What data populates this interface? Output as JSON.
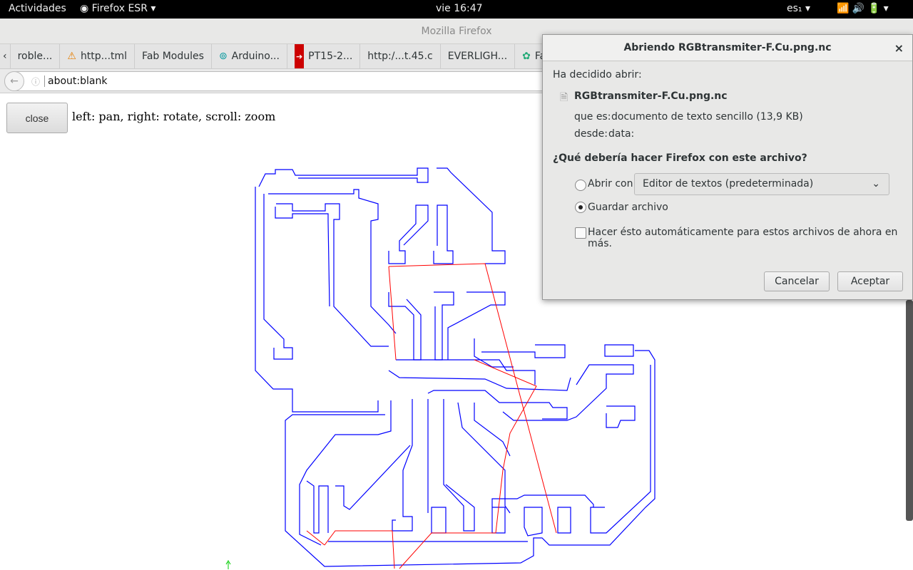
{
  "topbar": {
    "activities": "Actividades",
    "app": "Firefox ESR",
    "clock": "vie 16:47",
    "lang": "es₁"
  },
  "window": {
    "title": "Mozilla Firefox"
  },
  "tabs": [
    {
      "label": "roble...",
      "icon": ""
    },
    {
      "label": "http...tml",
      "icon": "warning-icon"
    },
    {
      "label": "Fab Modules",
      "icon": ""
    },
    {
      "label": "Arduino...",
      "icon": "arduino-icon"
    },
    {
      "label": "PT15-2...",
      "icon": "arrow-icon"
    },
    {
      "label": "http:/...t.45.c",
      "icon": ""
    },
    {
      "label": "EVERLIGH...",
      "icon": ""
    },
    {
      "label": "Fab Ac...",
      "icon": "fablab-icon"
    }
  ],
  "urlbar": {
    "value": "about:blank"
  },
  "page": {
    "close_label": "close",
    "hint": "left: pan, right: rotate, scroll: zoom"
  },
  "dialog": {
    "title": "Abriendo RGBtransmiter-F.Cu.png.nc",
    "intro": "Ha decidido abrir:",
    "filename": "RGBtransmiter-F.Cu.png.nc",
    "type_label": "que es:",
    "type_value": "documento de texto sencillo (13,9 KB)",
    "from_label": "desde:",
    "from_value": "data:",
    "question": "¿Qué debería hacer Firefox con este archivo?",
    "open_with": "Abrir con",
    "open_app": "Editor de textos (predeterminada)",
    "save": "Guardar archivo",
    "save_selected": true,
    "auto": "Hacer ésto automáticamente para estos archivos de ahora en más.",
    "auto_checked": false,
    "cancel": "Cancelar",
    "accept": "Aceptar"
  },
  "colors": {
    "toolpath": "#0000ff",
    "rapid": "#ff0000"
  }
}
